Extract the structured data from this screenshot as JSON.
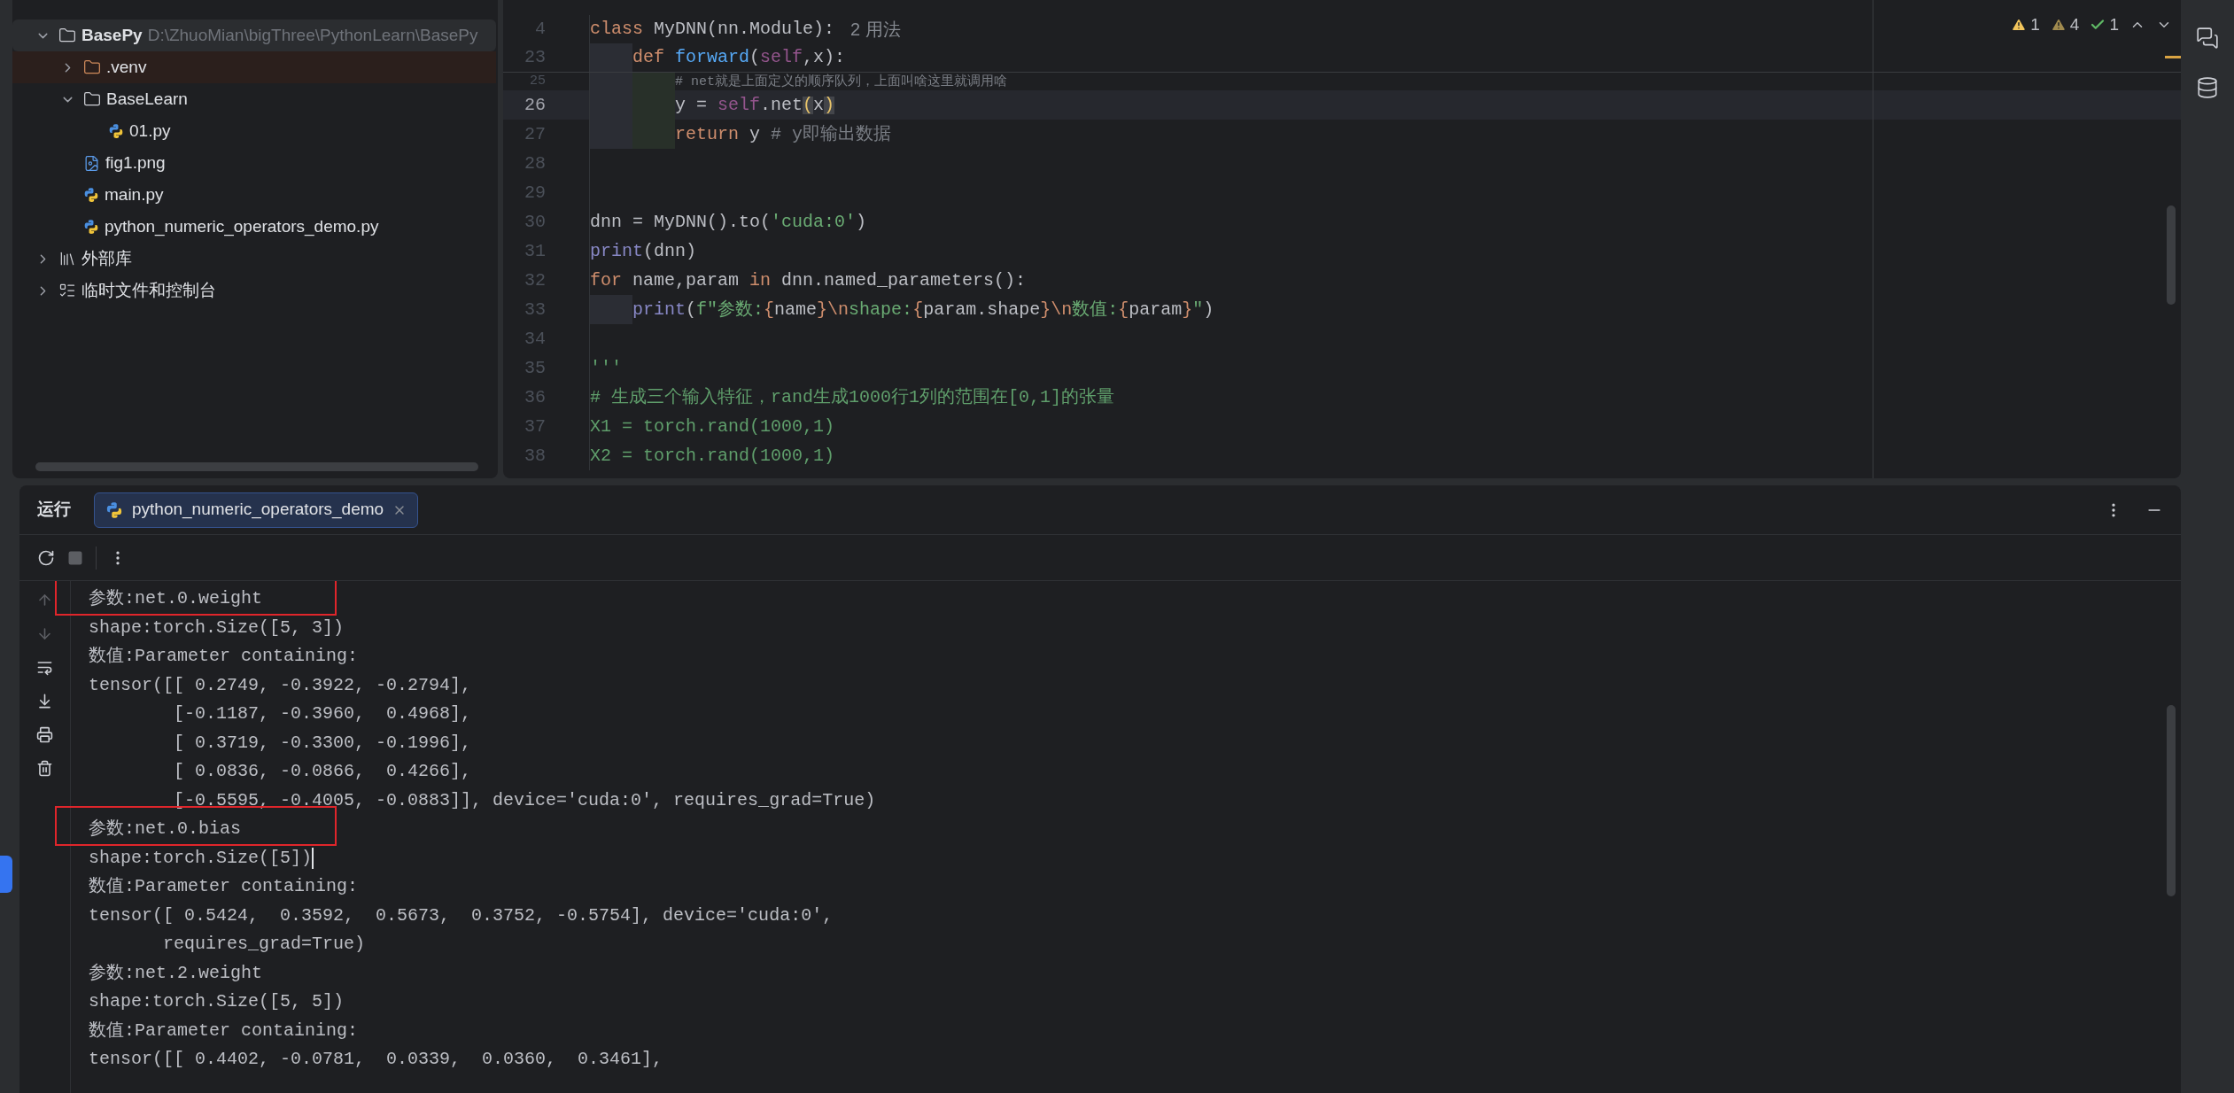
{
  "project_tree": [
    {
      "kind": "project",
      "name": "BasePy",
      "path": "D:\\ZhuoMian\\bigThree\\PythonLearn\\BasePy",
      "expanded": true,
      "selected": true,
      "children": [
        {
          "kind": "excluded_folder",
          "name": ".venv",
          "expanded": false,
          "selected": false
        },
        {
          "kind": "folder",
          "name": "BaseLearn",
          "expanded": true,
          "selected": false,
          "children": [
            {
              "kind": "python",
              "name": "01.py",
              "selected": false
            }
          ]
        },
        {
          "kind": "image",
          "name": "fig1.png",
          "selected": false
        },
        {
          "kind": "python",
          "name": "main.py",
          "selected": false
        },
        {
          "kind": "python",
          "name": "python_numeric_operators_demo.py",
          "selected": false
        }
      ]
    },
    {
      "kind": "library",
      "name": "外部库",
      "expanded": false,
      "selected": false
    },
    {
      "kind": "scratches",
      "name": "临时文件和控制台",
      "expanded": false,
      "selected": false
    }
  ],
  "editor": {
    "inspections": [
      {
        "kind": "warning",
        "count": "1"
      },
      {
        "kind": "weak_warning",
        "count": "4"
      },
      {
        "kind": "typo",
        "count": "1"
      }
    ],
    "sticky_lines": [
      {
        "number": "4",
        "tokens": [
          {
            "kind": "kw",
            "text": "class "
          },
          {
            "kind": "plain",
            "text": "MyDNN(nn.Module):"
          },
          {
            "kind": "hint",
            "text": "2 用法"
          }
        ]
      },
      {
        "number": "23",
        "tokens": [
          {
            "kind": "indent1"
          },
          {
            "kind": "kw",
            "text": "def "
          },
          {
            "kind": "fn",
            "text": "forward"
          },
          {
            "kind": "plain",
            "text": "("
          },
          {
            "kind": "self",
            "text": "self"
          },
          {
            "kind": "plain",
            "text": ",x):"
          }
        ]
      }
    ],
    "partial_line": {
      "number": "25",
      "tokens": [
        {
          "kind": "indent1"
        },
        {
          "kind": "indent2"
        },
        {
          "kind": "comment",
          "text": "# net就是上面定义的顺序队列，上面叫啥这里就调用啥"
        }
      ]
    },
    "lines": [
      {
        "number": "26",
        "current": true,
        "tokens": [
          {
            "kind": "indent1"
          },
          {
            "kind": "indent2"
          },
          {
            "kind": "plain",
            "text": "y = "
          },
          {
            "kind": "self",
            "text": "self"
          },
          {
            "kind": "plain",
            "text": ".net"
          },
          {
            "kind": "match",
            "text": "("
          },
          {
            "kind": "plain",
            "text": "x"
          },
          {
            "kind": "match",
            "text": ")"
          }
        ]
      },
      {
        "number": "27",
        "current": false,
        "tokens": [
          {
            "kind": "indent1"
          },
          {
            "kind": "indent2"
          },
          {
            "kind": "kw",
            "text": "return "
          },
          {
            "kind": "plain",
            "text": "y "
          },
          {
            "kind": "comment",
            "text": "# y即输出数据"
          }
        ]
      },
      {
        "number": "28",
        "current": false
      },
      {
        "number": "29",
        "current": false
      },
      {
        "number": "30",
        "current": false,
        "tokens": [
          {
            "kind": "plain",
            "text": "dnn = MyDNN().to("
          },
          {
            "kind": "str",
            "text": "'cuda:0'"
          },
          {
            "kind": "plain",
            "text": ")"
          }
        ]
      },
      {
        "number": "31",
        "current": false,
        "tokens": [
          {
            "kind": "builtin",
            "text": "print"
          },
          {
            "kind": "plain",
            "text": "(dnn)"
          }
        ]
      },
      {
        "number": "32",
        "current": false,
        "tokens": [
          {
            "kind": "kw",
            "text": "for "
          },
          {
            "kind": "plain",
            "text": "name,param "
          },
          {
            "kind": "kw",
            "text": "in "
          },
          {
            "kind": "plain",
            "text": "dnn.named_parameters():"
          }
        ]
      },
      {
        "number": "33",
        "current": false,
        "tokens": [
          {
            "kind": "indent1"
          },
          {
            "kind": "builtin",
            "text": "print"
          },
          {
            "kind": "plain",
            "text": "("
          },
          {
            "kind": "str",
            "text": "f\"参数:"
          },
          {
            "kind": "brace",
            "text": "{"
          },
          {
            "kind": "plain",
            "text": "name"
          },
          {
            "kind": "brace",
            "text": "}"
          },
          {
            "kind": "kw",
            "text": "\\n"
          },
          {
            "kind": "str",
            "text": "shape:"
          },
          {
            "kind": "brace",
            "text": "{"
          },
          {
            "kind": "plain",
            "text": "param.shape"
          },
          {
            "kind": "brace",
            "text": "}"
          },
          {
            "kind": "kw",
            "text": "\\n"
          },
          {
            "kind": "str",
            "text": "数值:"
          },
          {
            "kind": "brace",
            "text": "{"
          },
          {
            "kind": "plain",
            "text": "param"
          },
          {
            "kind": "brace",
            "text": "}"
          },
          {
            "kind": "str",
            "text": "\""
          },
          {
            "kind": "plain",
            "text": ")"
          }
        ]
      },
      {
        "number": "34",
        "current": false
      },
      {
        "number": "35",
        "current": false,
        "tokens": [
          {
            "kind": "doc",
            "text": "'''"
          }
        ]
      },
      {
        "number": "36",
        "current": false,
        "tokens": [
          {
            "kind": "doc",
            "text": "# 生成三个输入特征，rand生成1000行1列的范围在[0,1]的张量"
          }
        ]
      },
      {
        "number": "37",
        "current": false,
        "tokens": [
          {
            "kind": "doc",
            "text": "X1 = torch.rand(1000,1)"
          }
        ]
      },
      {
        "number": "38",
        "current": false,
        "tokens": [
          {
            "kind": "doc",
            "text": "X2 = torch.rand(1000,1)"
          }
        ]
      }
    ]
  },
  "run_panel": {
    "title": "运行",
    "tabs": [
      {
        "label": "python_numeric_operators_demo",
        "selected": true
      }
    ],
    "console": [
      {
        "text": "参数:net.0.weight",
        "boxed": true,
        "caret": false
      },
      {
        "text": "shape:torch.Size([5, 3])",
        "boxed": false,
        "caret": false
      },
      {
        "text": "数值:Parameter containing:",
        "boxed": false,
        "caret": false
      },
      {
        "text": "tensor([[ 0.2749, -0.3922, -0.2794],",
        "boxed": false,
        "caret": false
      },
      {
        "text": "        [-0.1187, -0.3960,  0.4968],",
        "boxed": false,
        "caret": false
      },
      {
        "text": "        [ 0.3719, -0.3300, -0.1996],",
        "boxed": false,
        "caret": false
      },
      {
        "text": "        [ 0.0836, -0.0866,  0.4266],",
        "boxed": false,
        "caret": false
      },
      {
        "text": "        [-0.5595, -0.4005, -0.0883]], device='cuda:0', requires_grad=True)",
        "boxed": false,
        "caret": false
      },
      {
        "text": "参数:net.0.bias",
        "boxed": true,
        "caret": false
      },
      {
        "text": "shape:torch.Size([5])",
        "boxed": false,
        "caret": true
      },
      {
        "text": "数值:Parameter containing:",
        "boxed": false,
        "caret": false
      },
      {
        "text": "tensor([ 0.5424,  0.3592,  0.5673,  0.3752, -0.5754], device='cuda:0',",
        "boxed": false,
        "caret": false
      },
      {
        "text": "       requires_grad=True)",
        "boxed": false,
        "caret": false
      },
      {
        "text": "参数:net.2.weight",
        "boxed": false,
        "caret": false
      },
      {
        "text": "shape:torch.Size([5, 5])",
        "boxed": false,
        "caret": false
      },
      {
        "text": "数值:Parameter containing:",
        "boxed": false,
        "caret": false
      },
      {
        "text": "tensor([[ 0.4402, -0.0781,  0.0339,  0.0360,  0.3461],",
        "boxed": false,
        "caret": false
      }
    ]
  }
}
